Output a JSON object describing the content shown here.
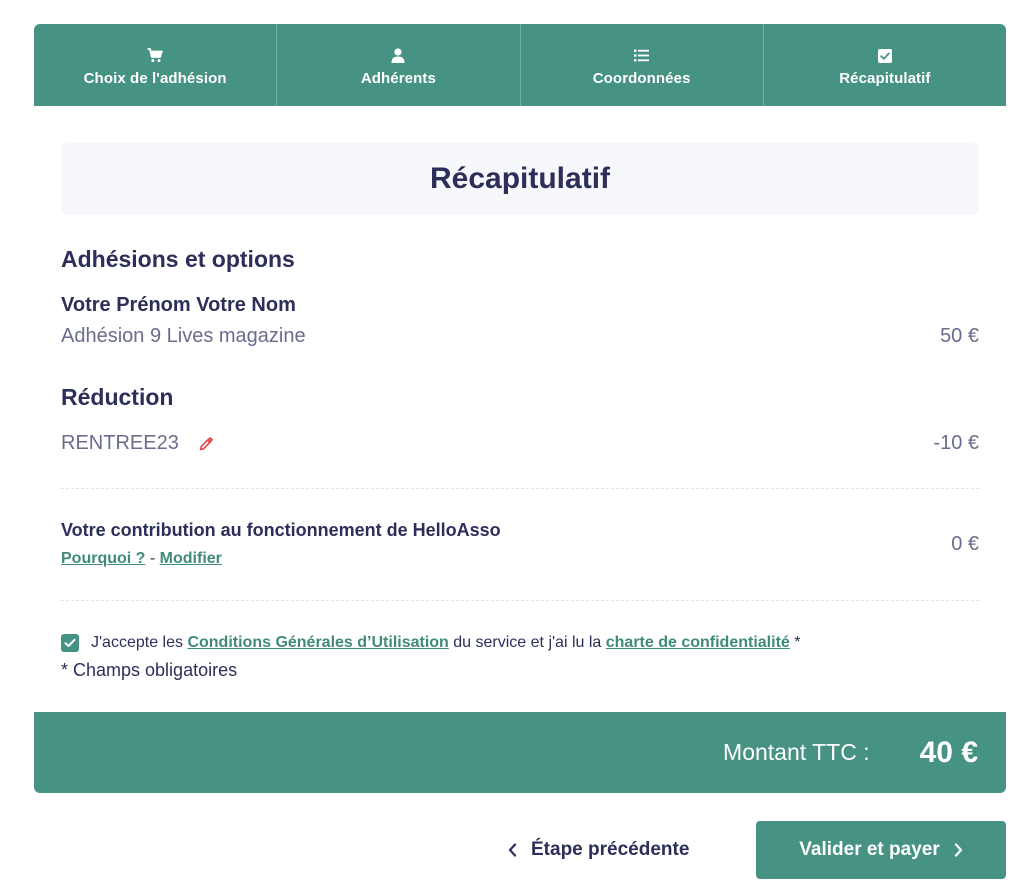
{
  "stepper": {
    "steps": [
      {
        "label": "Choix de l'adhésion",
        "icon": "cart-icon"
      },
      {
        "label": "Adhérents",
        "icon": "user-icon"
      },
      {
        "label": "Coordonnées",
        "icon": "list-icon"
      },
      {
        "label": "Récapitulatif",
        "icon": "checkbox-icon"
      }
    ]
  },
  "page": {
    "title": "Récapitulatif"
  },
  "memberships": {
    "section_title": "Adhésions et options",
    "member_name": "Votre Prénom Votre Nom",
    "item_label": "Adhésion 9 Lives magazine",
    "item_amount": "50 €"
  },
  "discount": {
    "section_title": "Réduction",
    "code": "RENTREE23",
    "amount": "-10 €",
    "edit_icon": "pencil-icon"
  },
  "contribution": {
    "title": "Votre contribution au fonctionnement de HelloAsso",
    "why_link": "Pourquoi ?",
    "separator": "-",
    "modify_link": "Modifier",
    "amount": "0 €"
  },
  "consent": {
    "checked": true,
    "text_before": "J'accepte les",
    "cgu_link": "Conditions Générales d’Utilisation",
    "text_middle": "du service et j'ai lu la",
    "privacy_link": "charte de confidentialité",
    "asterisk": "*",
    "required_note": "* Champs obligatoires"
  },
  "total": {
    "label": "Montant TTC :",
    "value": "40 €"
  },
  "actions": {
    "previous_label": "Étape précédente",
    "pay_label": "Valider et payer"
  },
  "colors": {
    "brand_green": "#479383",
    "navy_text": "#2b2f5a",
    "muted_text": "#6a6d8c",
    "edit_icon_red": "#e04848"
  }
}
